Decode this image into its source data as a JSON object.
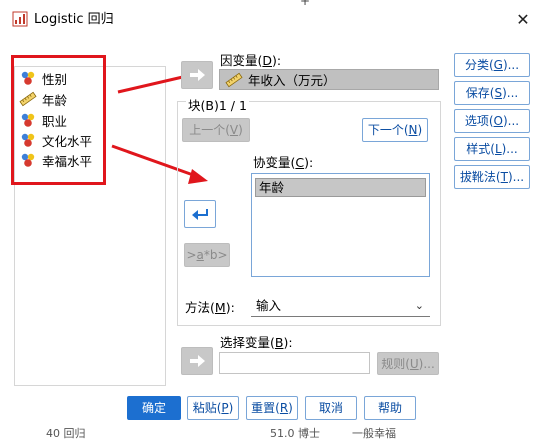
{
  "window": {
    "title": "Logistic 回归",
    "close_glyph": "✕",
    "background_fragment_top": "+",
    "background_fragments_bottom": [
      "40 回归",
      "51.0 博士",
      "一般幸福"
    ]
  },
  "source_variables": [
    {
      "label": "性别",
      "icon": "nominal-variable-icon"
    },
    {
      "label": "年龄",
      "icon": "scale-variable-icon"
    },
    {
      "label": "职业",
      "icon": "nominal-variable-icon"
    },
    {
      "label": "文化水平",
      "icon": "nominal-variable-icon"
    },
    {
      "label": "幸福水平",
      "icon": "nominal-variable-icon"
    }
  ],
  "dependent": {
    "label_prefix": "因变量(",
    "label_key": "D",
    "label_suffix": "):",
    "value": "年收入（万元）",
    "icon": "scale-variable-icon"
  },
  "block": {
    "label": "块(B)1 / 1",
    "prev_prefix": "上一个(",
    "prev_key": "V",
    "prev_suffix": ")",
    "next_prefix": "下一个(",
    "next_key": "N",
    "next_suffix": ")"
  },
  "covariates": {
    "label_prefix": "协变量(",
    "label_key": "C",
    "label_suffix": "):",
    "items": [
      "年龄"
    ],
    "interaction_prefix": ">",
    "interaction_key": "a",
    "interaction_suffix": "*b>"
  },
  "method": {
    "label_prefix": "方法(",
    "label_key": "M",
    "label_suffix": "):",
    "value": "输入",
    "chevron": "⌄"
  },
  "selection": {
    "label_prefix": "选择变量(",
    "label_key": "B",
    "label_suffix": "):",
    "value": "",
    "rule_prefix": "规则(",
    "rule_key": "U",
    "rule_suffix": ")..."
  },
  "side_buttons": [
    {
      "prefix": "分类(",
      "key": "G",
      "suffix": ")..."
    },
    {
      "prefix": "保存(",
      "key": "S",
      "suffix": ")..."
    },
    {
      "prefix": "选项(",
      "key": "O",
      "suffix": ")..."
    },
    {
      "prefix": "样式(",
      "key": "L",
      "suffix": ")..."
    },
    {
      "prefix": "拔靴法(",
      "key": "T",
      "suffix": ")..."
    }
  ],
  "footer_buttons": {
    "ok": {
      "label": "确定"
    },
    "paste": {
      "prefix": "粘贴(",
      "key": "P",
      "suffix": ")"
    },
    "reset": {
      "prefix": "重置(",
      "key": "R",
      "suffix": ")"
    },
    "cancel": {
      "label": "取消"
    },
    "help": {
      "label": "帮助"
    }
  },
  "colors": {
    "accent": "#1c6fd0",
    "link_text": "#0b4da2",
    "annotation_red": "#e0161c",
    "disabled_fill": "#c8c8c8"
  }
}
